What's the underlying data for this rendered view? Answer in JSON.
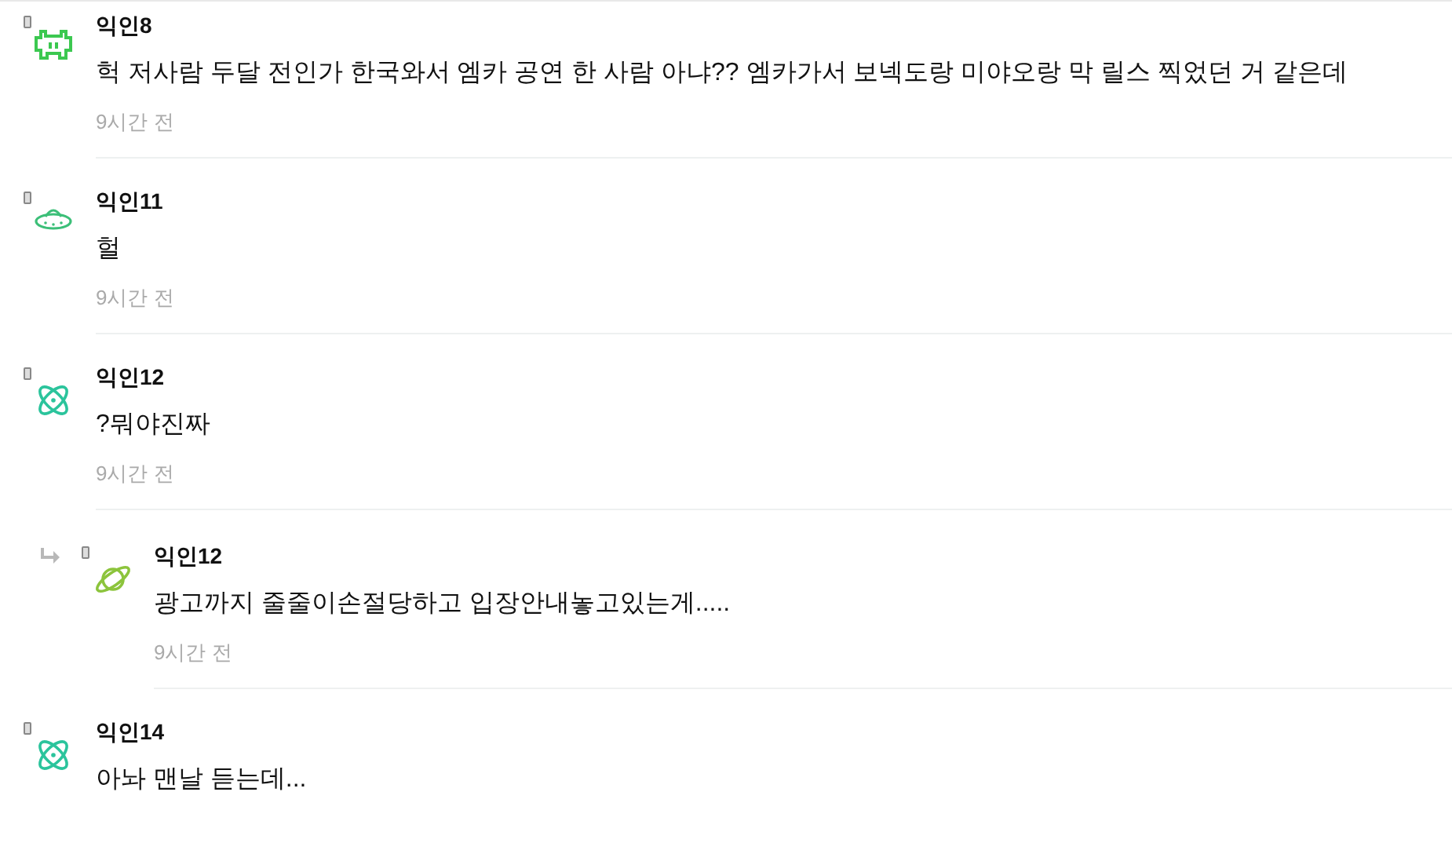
{
  "comments": [
    {
      "kind": "comment",
      "avatar": {
        "kind": "invader"
      },
      "author": "익인8",
      "text": "헉 저사람 두달 전인가 한국와서 엠카 공연 한 사람 아냐?? 엠카가서 보넥도랑 미야오랑 막 릴스 찍었던 거 같은데",
      "time": "9시간 전"
    },
    {
      "kind": "comment",
      "avatar": {
        "kind": "ufo"
      },
      "author": "익인11",
      "text": "헐",
      "time": "9시간 전"
    },
    {
      "kind": "comment",
      "avatar": {
        "kind": "atom"
      },
      "author": "익인12",
      "text": "?뭐야진짜",
      "time": "9시간 전"
    },
    {
      "kind": "reply",
      "avatar": {
        "kind": "planet"
      },
      "author": "익인12",
      "text": "광고까지 줄줄이손절당하고 입장안내놓고있는게.....",
      "time": "9시간 전"
    },
    {
      "kind": "comment",
      "avatar": {
        "kind": "atom"
      },
      "author": "익인14",
      "text": "아놔 맨날 듣는데..."
    }
  ]
}
